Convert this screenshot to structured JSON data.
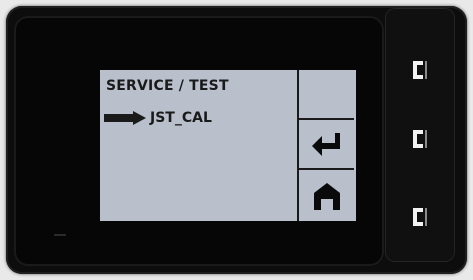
{
  "screen": {
    "title": "SERVICE / TEST",
    "selected_item": "JST_CAL",
    "colors": {
      "background": "#b9c0cc",
      "text": "#1a1a1a"
    }
  },
  "softkeys": [
    {
      "icon": "blank-icon"
    },
    {
      "icon": "enter-return-icon"
    },
    {
      "icon": "home-icon"
    }
  ],
  "hardware_buttons": [
    {
      "icon": "bracket-button-icon"
    },
    {
      "icon": "bracket-button-icon"
    },
    {
      "icon": "bracket-button-icon"
    }
  ]
}
